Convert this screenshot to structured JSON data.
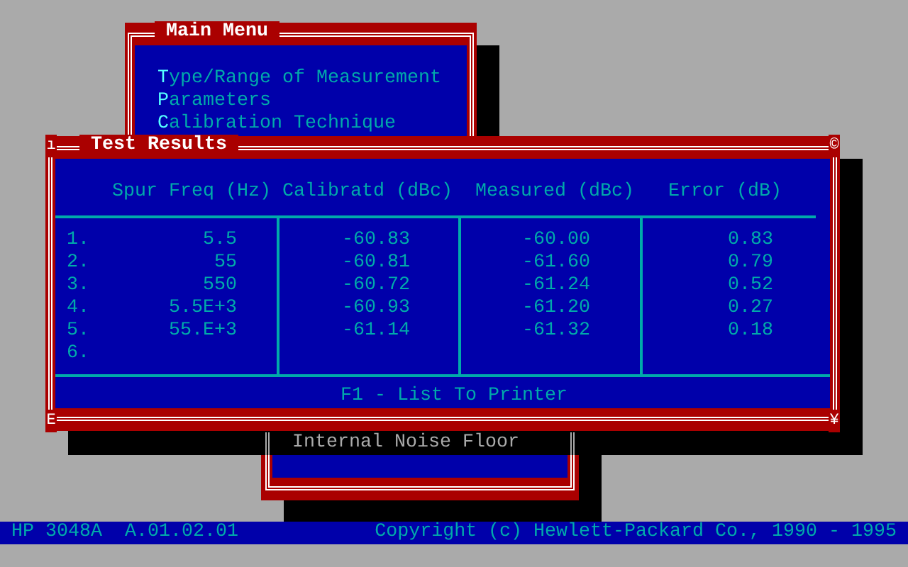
{
  "main_menu": {
    "title": "Main Menu",
    "items": [
      {
        "label": "Type/Range of Measurement"
      },
      {
        "label": "Parameters"
      },
      {
        "label": "Calibration Technique"
      }
    ]
  },
  "submenu": {
    "items": [
      {
        "label": "Internal Noise Floor",
        "dimmed": true
      }
    ]
  },
  "test_results": {
    "title": "Test Results",
    "corners": [
      "ı",
      "©",
      "E",
      "¥"
    ],
    "columns": [
      "Spur Freq (Hz)",
      "Calibratd (dBc)",
      "Measured (dBc)",
      "Error (dB)"
    ],
    "rows": [
      {
        "index": "1.",
        "spur_freq": "5.5",
        "calibrated": "-60.83",
        "measured": "-60.00",
        "error": "0.83"
      },
      {
        "index": "2.",
        "spur_freq": "55",
        "calibrated": "-60.81",
        "measured": "-61.60",
        "error": "0.79"
      },
      {
        "index": "3.",
        "spur_freq": "550",
        "calibrated": "-60.72",
        "measured": "-61.24",
        "error": "0.52"
      },
      {
        "index": "4.",
        "spur_freq": "5.5E+3",
        "calibrated": "-60.93",
        "measured": "-61.20",
        "error": "0.27"
      },
      {
        "index": "5.",
        "spur_freq": "55.E+3",
        "calibrated": "-61.14",
        "measured": "-61.32",
        "error": "0.18"
      },
      {
        "index": "6."
      }
    ],
    "footer": "F1 - List To Printer"
  },
  "status_bar": {
    "product": "HP 3048A",
    "version": "A.01.02.01",
    "copyright": "Copyright (c) Hewlett-Packard Co., 1990 - 1995"
  }
}
